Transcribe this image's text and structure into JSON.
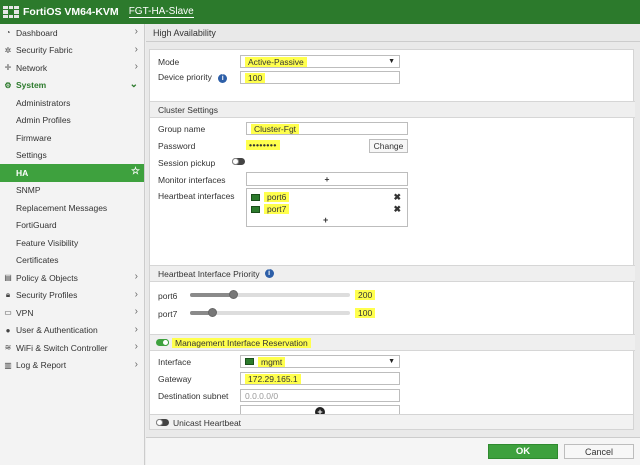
{
  "topbar": {
    "title": "FortiOS VM64-KVM",
    "hostname": "FGT-HA-Slave"
  },
  "sidebar": {
    "items": [
      {
        "label": "Dashboard",
        "icon": "dashboard-icon"
      },
      {
        "label": "Security Fabric",
        "icon": "security-fabric-icon"
      },
      {
        "label": "Network",
        "icon": "network-icon"
      },
      {
        "label": "System",
        "icon": "gear-icon"
      },
      {
        "label": "Policy & Objects",
        "icon": "policy-icon"
      },
      {
        "label": "Security Profiles",
        "icon": "lock-icon"
      },
      {
        "label": "VPN",
        "icon": "vpn-icon"
      },
      {
        "label": "User & Authentication",
        "icon": "user-icon"
      },
      {
        "label": "WiFi & Switch Controller",
        "icon": "wifi-icon"
      },
      {
        "label": "Log & Report",
        "icon": "log-icon"
      }
    ],
    "system_sub": [
      "Administrators",
      "Admin Profiles",
      "Firmware",
      "Settings",
      "HA",
      "SNMP",
      "Replacement Messages",
      "FortiGuard",
      "Feature Visibility",
      "Certificates"
    ]
  },
  "page": {
    "title": "High Availability"
  },
  "form": {
    "mode_label": "Mode",
    "mode_value": "Active-Passive",
    "device_priority_label": "Device priority",
    "device_priority_value": "100",
    "cluster_settings_header": "Cluster Settings",
    "group_name_label": "Group name",
    "group_name_value": "Cluster-Fgt",
    "password_label": "Password",
    "password_value": "••••••••",
    "change_button": "Change",
    "session_pickup_label": "Session pickup",
    "session_pickup_on": false,
    "monitor_interfaces_label": "Monitor interfaces",
    "add_symbol": "+",
    "heartbeat_interfaces_label": "Heartbeat interfaces",
    "heartbeat_interfaces": [
      "port6",
      "port7"
    ],
    "remove_symbol": "✖",
    "heartbeat_priority_header": "Heartbeat Interface Priority",
    "priorities": [
      {
        "port": "port6",
        "value": "200",
        "level": 0.27
      },
      {
        "port": "port7",
        "value": "100",
        "level": 0.14
      }
    ],
    "mgmt_header": "Management Interface Reservation",
    "mgmt_on": true,
    "interface_label": "Interface",
    "interface_value": "mgmt",
    "gateway_label": "Gateway",
    "gateway_value": "172.29.165.1",
    "dest_subnet_label": "Destination subnet",
    "dest_subnet_placeholder": "0.0.0.0/0",
    "unicast_label": "Unicast Heartbeat",
    "unicast_on": false
  },
  "footer": {
    "ok_label": "OK",
    "cancel_label": "Cancel"
  },
  "colors": {
    "brand_green": "#2c7a2c",
    "active_green": "#3ea13e",
    "highlight": "#ffff4d"
  }
}
